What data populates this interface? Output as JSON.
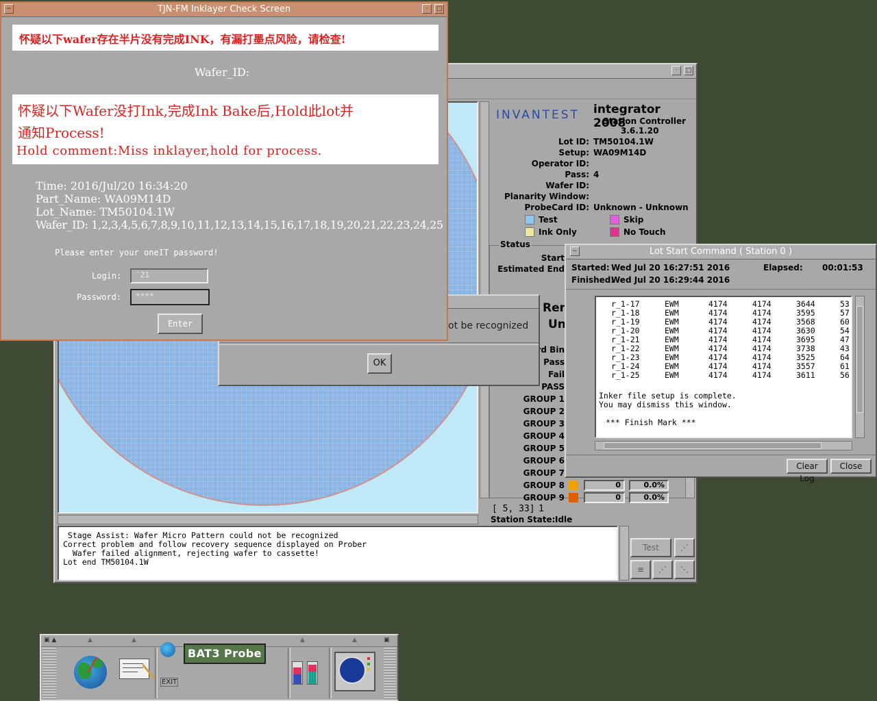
{
  "inklayer": {
    "title": "TJN-FM Inklayer Check Screen",
    "warning1": "怀疑以下wafer存在半片没有完成INK，有漏打墨点风险，请检查!",
    "wafer_id_label": "Wafer_ID:",
    "warning2_line1": "怀疑以下Wafer没打Ink,完成Ink Bake后,Hold此lot并",
    "warning2_line2": "通知Process!",
    "warning2_line3": "Hold comment:Miss inklayer,hold for process.",
    "time_label": "Time:",
    "time_value": "2016/Jul/20 16:34:20",
    "part_label": "Part_Name:",
    "part_value": "WA09M14D",
    "lot_label": "Lot_Name:",
    "lot_value": "TM50104.1W",
    "wafers_label": "Wafer_ID:",
    "wafers_value": "1,2,3,4,5,6,7,8,9,10,11,12,13,14,15,16,17,18,19,20,21,22,23,24,25",
    "prompt": "Please enter your oneIT password!",
    "login_label": "Login:",
    "login_value": "`21",
    "password_label": "Password:",
    "password_value": "****",
    "enter_label": "Enter"
  },
  "integrator": {
    "logo": "INVANTEST",
    "product": "integrator 2008",
    "subtitle": "Station Controller",
    "version": "3.6.1.20",
    "fields": [
      {
        "label": "Lot ID:",
        "value": "TM50104.1W"
      },
      {
        "label": "Setup:",
        "value": "WA09M14D"
      },
      {
        "label": "Operator ID:",
        "value": ""
      },
      {
        "label": "Pass:",
        "value": "4"
      },
      {
        "label": "Wafer ID:",
        "value": ""
      },
      {
        "label": "Planarity Window:",
        "value": ""
      },
      {
        "label": "ProbeCard ID:",
        "value": "Unknown - Unknown"
      }
    ],
    "legend": [
      {
        "label": "Test",
        "color": "#8cc8f0"
      },
      {
        "label": "Skip",
        "color": "#e060e0"
      },
      {
        "label": "Ink Only",
        "color": "#f0e6a0"
      },
      {
        "label": "No Touch",
        "color": "#e03090"
      }
    ],
    "status_label": "Status",
    "start_label": "Start",
    "est_end_label": "Estimated End",
    "rem_label": "Rem",
    "uns_label": "Uns",
    "bin_label": "rd Bin",
    "pass_label": "Pass",
    "fail_label": "Fail",
    "pass_caps": "PASS",
    "groups": [
      {
        "label": "GROUP 1"
      },
      {
        "label": "GROUP 2"
      },
      {
        "label": "GROUP 3"
      },
      {
        "label": "GROUP 4"
      },
      {
        "label": "GROUP 5"
      },
      {
        "label": "GROUP 6"
      },
      {
        "label": "GROUP 7"
      },
      {
        "label": "GROUP 8",
        "color": "#f0a000",
        "count": "0",
        "pct": "0.0%"
      },
      {
        "label": "GROUP 9",
        "color": "#e06000",
        "count": "0",
        "pct": "0.0%"
      }
    ],
    "coords": "[ 5, 33]",
    "coords_val": "1",
    "station_state_label": "Station State:",
    "station_state": "Idle",
    "log_lines": [
      " Stage Assist: Wafer Micro Pattern could not be recognized",
      "Correct problem and follow recovery sequence displayed on Prober",
      "  Wafer failed alignment, rejecting wafer to cassette!",
      "Lot end TM50104.1W"
    ],
    "test_button": "Test"
  },
  "dialog": {
    "message_fragment": "ot be recognized",
    "ok_label": "OK"
  },
  "lotstart": {
    "title": "Lot Start Command ( Station 0 )",
    "started_label": "Started:",
    "started": "Wed Jul 20 16:27:51 2016",
    "elapsed_label": "Elapsed:",
    "elapsed": "00:01:53",
    "finished_label": "Finished:",
    "finished": "Wed Jul 20 16:29:44 2016",
    "rows": [
      [
        "r_1-17",
        "EWM",
        "4174",
        "4174",
        "3644",
        "53"
      ],
      [
        "r_1-18",
        "EWM",
        "4174",
        "4174",
        "3595",
        "57"
      ],
      [
        "r_1-19",
        "EWM",
        "4174",
        "4174",
        "3568",
        "60"
      ],
      [
        "r_1-20",
        "EWM",
        "4174",
        "4174",
        "3630",
        "54"
      ],
      [
        "r_1-21",
        "EWM",
        "4174",
        "4174",
        "3695",
        "47"
      ],
      [
        "r_1-22",
        "EWM",
        "4174",
        "4174",
        "3738",
        "43"
      ],
      [
        "r_1-23",
        "EWM",
        "4174",
        "4174",
        "3525",
        "64"
      ],
      [
        "r_1-24",
        "EWM",
        "4174",
        "4174",
        "3557",
        "61"
      ],
      [
        "r_1-25",
        "EWM",
        "4174",
        "4174",
        "3611",
        "56"
      ]
    ],
    "msg1": "Inker file setup is complete.",
    "msg2": "You may dismiss this window.",
    "msg3": "*** Finish Mark ***",
    "clear_log": "Clear Log",
    "close": "Close"
  },
  "taskbar": {
    "probe_label": "BAT3 Probe",
    "exit_label": "EXIT"
  }
}
